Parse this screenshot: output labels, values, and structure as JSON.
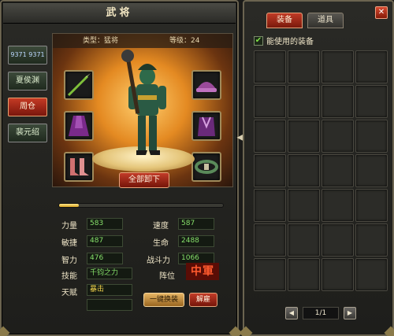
{
  "window": {
    "title": "武将"
  },
  "heroes": [
    {
      "name": "9371 9371"
    },
    {
      "name": "夏侯渊"
    },
    {
      "name": "周仓"
    },
    {
      "name": "裴元绍"
    }
  ],
  "stage": {
    "type_label": "类型：猛将",
    "level_label": "等级：24",
    "unequip_all": "全部卸下"
  },
  "equipment_slots": [
    {
      "name": "weapon",
      "icon": "spear-icon"
    },
    {
      "name": "helmet",
      "icon": "helmet-icon"
    },
    {
      "name": "cloak",
      "icon": "cloak-icon"
    },
    {
      "name": "armor",
      "icon": "armor-icon"
    },
    {
      "name": "boots",
      "icon": "boots-icon"
    },
    {
      "name": "belt",
      "icon": "belt-icon"
    }
  ],
  "exp": {
    "fraction": 0.12
  },
  "stats": {
    "strength_label": "力量",
    "strength": "583",
    "speed_label": "速度",
    "speed": "587",
    "agility_label": "敏捷",
    "agility": "487",
    "hp_label": "生命",
    "hp": "2488",
    "intellect_label": "智力",
    "intellect": "476",
    "power_label": "战斗力",
    "power": "1066",
    "skill_label": "技能",
    "skill": "千钧之力",
    "formation_label": "阵位",
    "formation": "中軍",
    "talent_label": "天赋",
    "talent": "暴击",
    "talent2": ""
  },
  "actions": {
    "one_key": "一键换装",
    "release": "解雇"
  },
  "right": {
    "tabs": [
      {
        "label": "装备"
      },
      {
        "label": "道具"
      }
    ],
    "close": "✕",
    "filter_label": "能使用的装备",
    "filter_checked": "✔",
    "page": "1/1",
    "prev": "◀",
    "next": "▶"
  },
  "colors": {
    "accent_red": "#c03a26",
    "value_green": "#86e06a",
    "value_yellow": "#f5d54c",
    "exp_gold": "#d6a222"
  }
}
